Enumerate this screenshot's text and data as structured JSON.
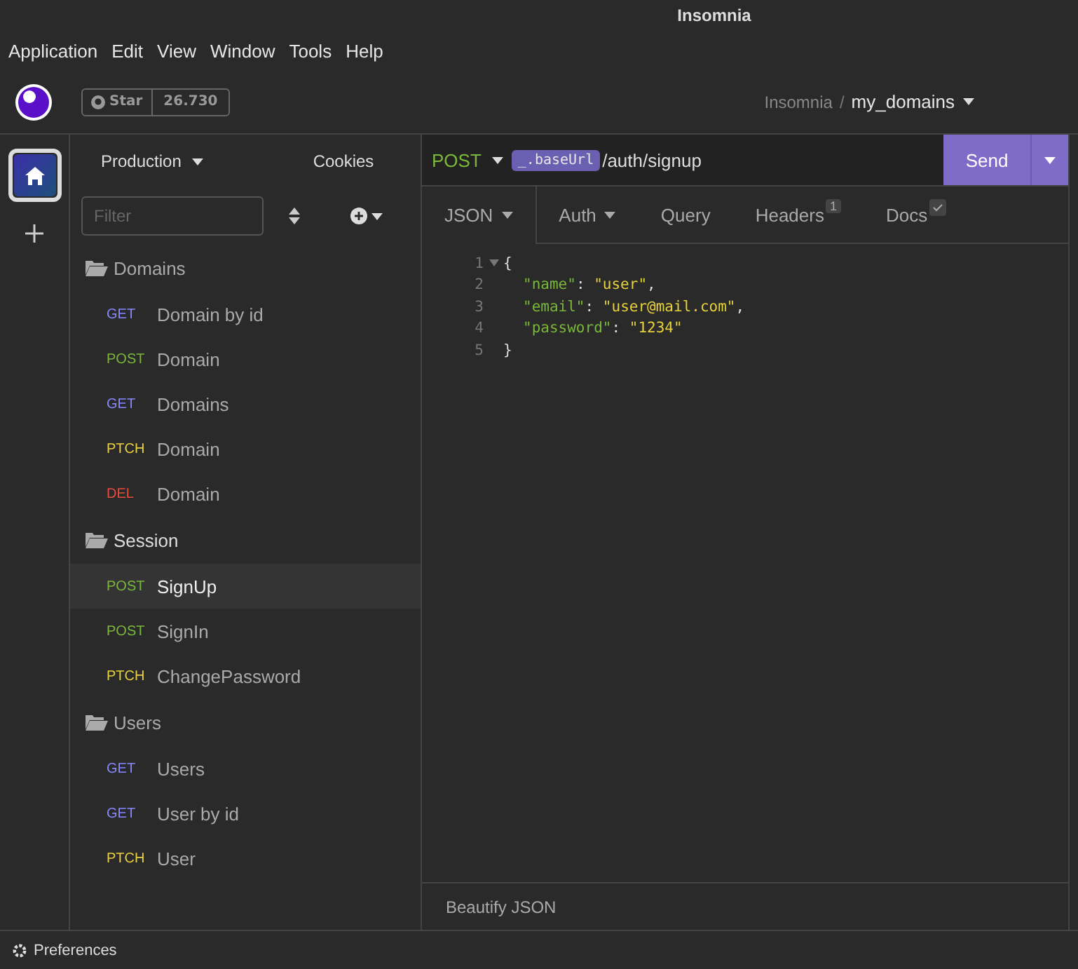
{
  "window": {
    "title": "Insomnia"
  },
  "menu": [
    "Application",
    "Edit",
    "View",
    "Window",
    "Tools",
    "Help"
  ],
  "header": {
    "star_label": "Star",
    "star_count": "26.730",
    "breadcrumb": {
      "root": "Insomnia",
      "separator": "/",
      "project": "my_domains"
    }
  },
  "sidebar": {
    "environment": "Production",
    "cookies": "Cookies",
    "filter": {
      "placeholder": "Filter"
    },
    "folders": [
      {
        "name": "Domains",
        "children": [
          {
            "method": "GET",
            "name": "Domain by id",
            "selected": false
          },
          {
            "method": "POST",
            "name": "Domain",
            "selected": false
          },
          {
            "method": "GET",
            "name": "Domains",
            "selected": false
          },
          {
            "method": "PTCH",
            "name": "Domain",
            "selected": false
          },
          {
            "method": "DEL",
            "name": "Domain",
            "selected": false
          }
        ]
      },
      {
        "name": "Session",
        "children": [
          {
            "method": "POST",
            "name": "SignUp",
            "selected": true
          },
          {
            "method": "POST",
            "name": "SignIn",
            "selected": false
          },
          {
            "method": "PTCH",
            "name": "ChangePassword",
            "selected": false
          }
        ]
      },
      {
        "name": "Users",
        "children": [
          {
            "method": "GET",
            "name": "Users",
            "selected": false
          },
          {
            "method": "GET",
            "name": "User by id",
            "selected": false
          },
          {
            "method": "PTCH",
            "name": "User",
            "selected": false
          }
        ]
      }
    ]
  },
  "request": {
    "method": "POST",
    "base_tag": "_.baseUrl",
    "path": "/auth/signup",
    "send": "Send",
    "tabs": [
      {
        "label": "JSON",
        "selected": true,
        "caret": true
      },
      {
        "label": "Auth",
        "selected": false,
        "caret": true
      },
      {
        "label": "Query",
        "selected": false
      },
      {
        "label": "Headers",
        "selected": false,
        "badge": "1"
      },
      {
        "label": "Docs",
        "selected": false,
        "checked": true
      }
    ],
    "body": [
      {
        "number": "1",
        "tokens": [
          {
            "kind": "punct",
            "text": "{"
          }
        ],
        "children": [
          {
            "number": "2",
            "tokens": [
              {
                "kind": "key",
                "text": "\"name\""
              },
              {
                "kind": "punct",
                "text": ": "
              },
              {
                "kind": "string",
                "text": "\"user\""
              },
              {
                "kind": "punct",
                "text": ","
              }
            ]
          },
          {
            "number": "3",
            "tokens": [
              {
                "kind": "key",
                "text": "\"email\""
              },
              {
                "kind": "punct",
                "text": ": "
              },
              {
                "kind": "string",
                "text": "\"user@mail.com\""
              },
              {
                "kind": "punct",
                "text": ","
              }
            ]
          },
          {
            "number": "4",
            "tokens": [
              {
                "kind": "key",
                "text": "\"password\""
              },
              {
                "kind": "punct",
                "text": ": "
              },
              {
                "kind": "string",
                "text": "\"1234\""
              }
            ]
          }
        ]
      },
      {
        "number": "5",
        "tokens": [
          {
            "kind": "punct",
            "text": "}"
          }
        ]
      }
    ],
    "footer": "Beautify JSON"
  },
  "status_bar": {
    "preferences": "Preferences"
  }
}
